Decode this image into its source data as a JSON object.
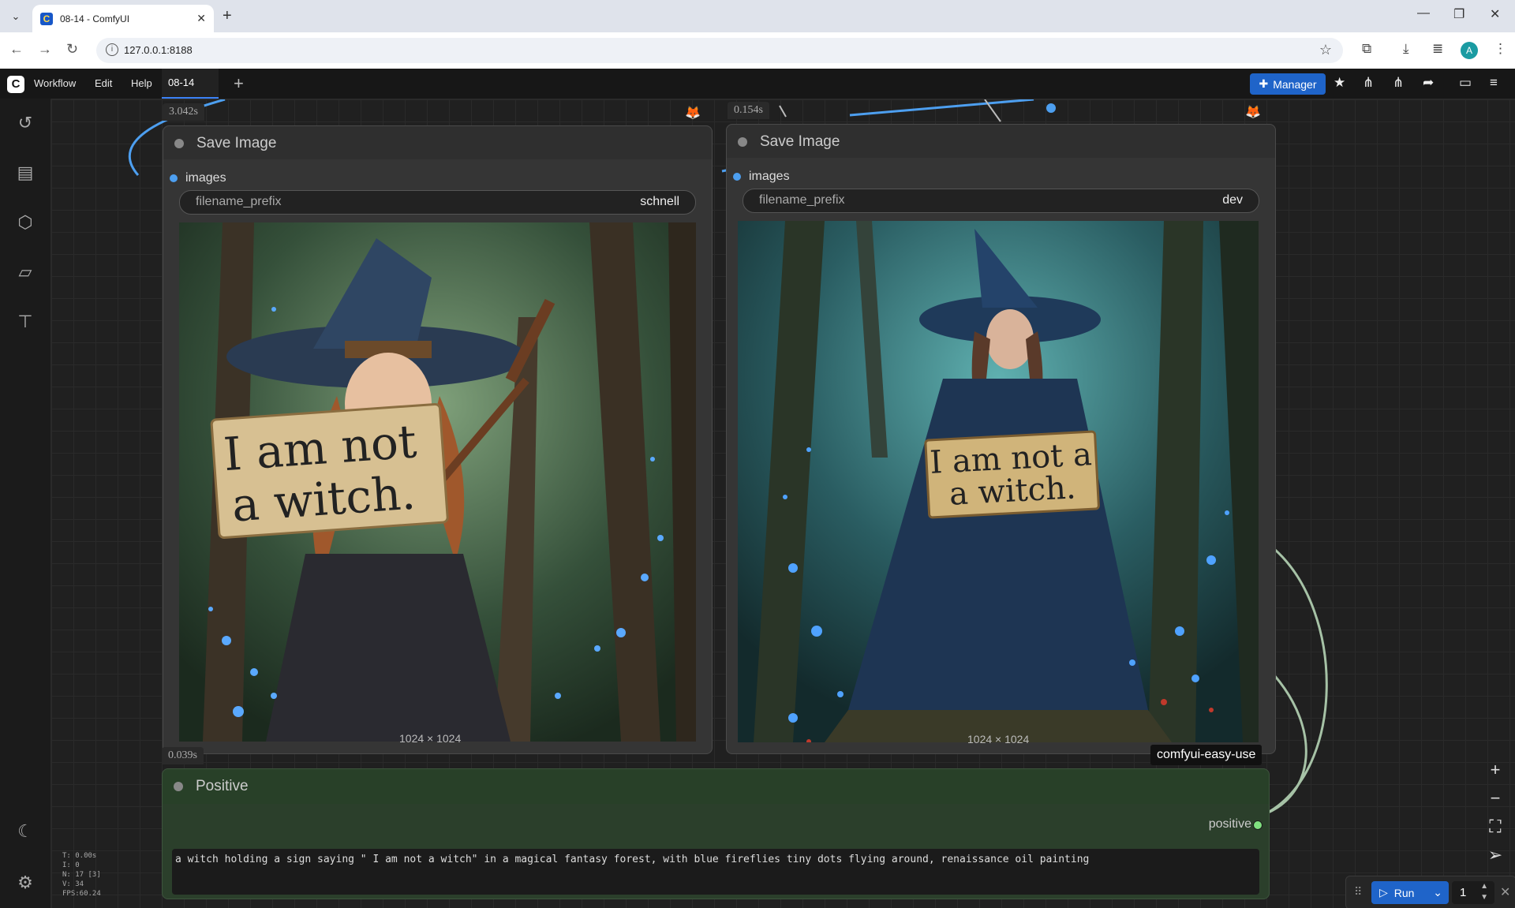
{
  "browser": {
    "tab_title": "08-14 - ComfyUI",
    "url": "127.0.0.1:8188",
    "profile_initial": "A"
  },
  "menu": {
    "items": [
      "Workflow",
      "Edit",
      "Help"
    ],
    "workflow_tab": "08-14",
    "manager_label": "Manager"
  },
  "nodes": {
    "save_left": {
      "title": "Save Image",
      "input": "images",
      "widget_name": "filename_prefix",
      "widget_value": "schnell",
      "dims": "1024 × 1024",
      "exec_time": "3.042s",
      "sign_line1": "I am not",
      "sign_line2": "a witch."
    },
    "save_right": {
      "title": "Save Image",
      "input": "images",
      "widget_name": "filename_prefix",
      "widget_value": "dev",
      "dims": "1024 × 1024",
      "exec_time": "0.154s",
      "sign_line1": "I am not a",
      "sign_line2": "a witch."
    },
    "positive": {
      "title": "Positive",
      "exec_time": "0.039s",
      "output": "positive",
      "prompt": "a witch holding a sign saying \" I am not a witch\" in a magical fantasy forest, with blue fireflies tiny dots flying around, renaissance oil painting"
    }
  },
  "group_label": "comfyui-easy-use",
  "stats": [
    "T: 0.00s",
    "I: 0",
    "N: 17 [3]",
    "V: 34",
    "FPS:60.24"
  ],
  "run": {
    "label": "Run",
    "count": "1"
  },
  "colors": {
    "accent": "#1f64c9",
    "link": "#4d9ff0",
    "positive_node": "#2b3f2b"
  }
}
